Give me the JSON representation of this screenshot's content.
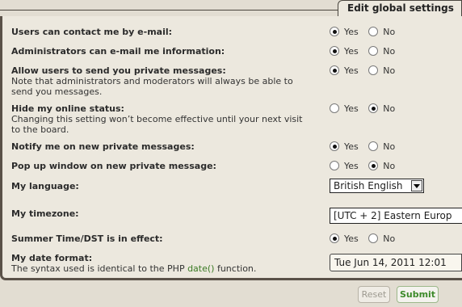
{
  "tab": {
    "title": "Edit global settings"
  },
  "settings": [
    {
      "label": "Users can contact me by e-mail:",
      "yes": "Yes",
      "no": "No",
      "value": "yes"
    },
    {
      "label": "Administrators can e-mail me information:",
      "yes": "Yes",
      "no": "No",
      "value": "yes"
    },
    {
      "label": "Allow users to send you private messages:",
      "note": "Note that administrators and moderators will always be able to send you messages.",
      "yes": "Yes",
      "no": "No",
      "value": "yes"
    },
    {
      "label": "Hide my online status:",
      "note": "Changing this setting won’t become effective until your next visit to the board.",
      "yes": "Yes",
      "no": "No",
      "value": "no"
    },
    {
      "label": "Notify me on new private messages:",
      "yes": "Yes",
      "no": "No",
      "value": "yes"
    },
    {
      "label": "Pop up window on new private message:",
      "yes": "Yes",
      "no": "No",
      "value": "no"
    }
  ],
  "language": {
    "label": "My language:",
    "value": "British English"
  },
  "timezone": {
    "label": "My timezone:",
    "value": "[UTC + 2] Eastern Europ"
  },
  "dst": {
    "label": "Summer Time/DST is in effect:",
    "yes": "Yes",
    "no": "No",
    "value": "yes"
  },
  "dateformat": {
    "label": "My date format:",
    "note_before": "The syntax used is identical to the PHP ",
    "note_link": "date()",
    "note_after": " function.",
    "value": "Tue Jun 14, 2011 12:01"
  },
  "buttons": {
    "reset": "Reset",
    "submit": "Submit"
  }
}
